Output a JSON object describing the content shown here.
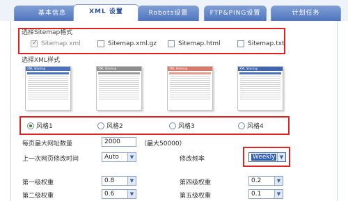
{
  "tabs": [
    {
      "label": "基本信息",
      "active": false
    },
    {
      "label": "XML 设置",
      "active": true
    },
    {
      "label": "Robots设置",
      "active": false
    },
    {
      "label": "FTP&PING设置",
      "active": false
    },
    {
      "label": "计划任务",
      "active": false
    }
  ],
  "sitemap_format": {
    "title": "选择Sitemap格式",
    "options": [
      {
        "label": "Sitemap.xml",
        "checked": true,
        "disabled": true
      },
      {
        "label": "Sitemap.xml.gz",
        "checked": false,
        "disabled": false
      },
      {
        "label": "Sitemap.html",
        "checked": false,
        "disabled": false
      },
      {
        "label": "Sitemap.txt",
        "checked": false,
        "disabled": false
      }
    ]
  },
  "xml_style": {
    "title": "选择XML样式",
    "thumb_title": "XML Sitemap",
    "styles": [
      {
        "label": "风格1",
        "selected": true,
        "color": "#4b72b8"
      },
      {
        "label": "风格2",
        "selected": false,
        "color": "#9a9a9a"
      },
      {
        "label": "风格3",
        "selected": false,
        "color": "#d97b6c"
      },
      {
        "label": "风格4",
        "selected": false,
        "color": "#4b72b8"
      }
    ]
  },
  "settings": {
    "max_urls_label": "每页最大网址数量",
    "max_urls_value": "2000",
    "max_urls_hint": "（最大50000）",
    "last_mod_label": "上一次网页修改时间",
    "last_mod_value": "Auto",
    "changefreq_label": "修改频率",
    "changefreq_value": "Weekly",
    "level1_label": "第一级权重",
    "level1_value": "0.8",
    "level4_label": "第四级权重",
    "level4_value": "0.2",
    "level2_label": "第二级权重",
    "level2_value": "0.6",
    "level5_label": "第五级权重",
    "level5_value": "0.1"
  },
  "colors": {
    "highlight_border": "#e0231e",
    "tab_blue": "#4f76bf"
  }
}
